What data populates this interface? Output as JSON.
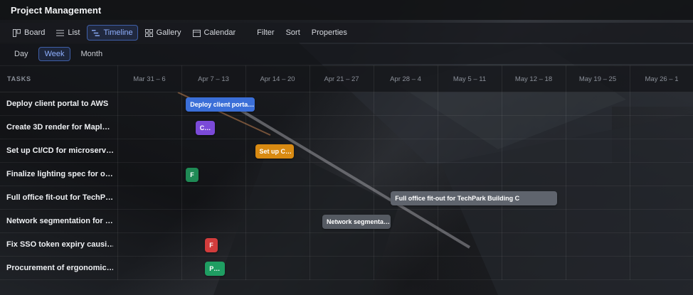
{
  "app": {
    "title": "Project Management"
  },
  "views": [
    {
      "label": "Board",
      "icon": "board-icon",
      "active": false
    },
    {
      "label": "List",
      "icon": "list-icon",
      "active": false
    },
    {
      "label": "Timeline",
      "icon": "timeline-icon",
      "active": true
    },
    {
      "label": "Gallery",
      "icon": "gallery-icon",
      "active": false
    },
    {
      "label": "Calendar",
      "icon": "calendar-icon",
      "active": false
    }
  ],
  "toolbar": {
    "filter": "Filter",
    "sort": "Sort",
    "properties": "Properties"
  },
  "zoom": [
    {
      "label": "Day",
      "active": false
    },
    {
      "label": "Week",
      "active": true
    },
    {
      "label": "Month",
      "active": false
    }
  ],
  "timeline": {
    "tasks_header": "TASKS",
    "weeks": [
      "Mar 31 – 6",
      "Apr 7 – 13",
      "Apr 14 – 20",
      "Apr 21 – 27",
      "Apr 28 – 4",
      "May 5 – 11",
      "May 12 – 18",
      "May 19 – 25",
      "May 26 – 1"
    ],
    "tasks": [
      {
        "name": "Deploy client portal to AWS",
        "bar_label": "Deploy client porta…",
        "color": "#3b6fd8",
        "start_week": 1.07,
        "span_weeks": 1.07
      },
      {
        "name": "Create 3D render for Mapl…",
        "bar_label": "C…",
        "color": "#7b4ad8",
        "start_week": 1.22,
        "span_weeks": 0.3
      },
      {
        "name": "Set up CI/CD for microserv…",
        "bar_label": "Set up C…",
        "color": "#d88a12",
        "start_week": 2.15,
        "span_weeks": 0.6
      },
      {
        "name": "Finalize lighting spec for o…",
        "bar_label": "F",
        "color": "#1f8a55",
        "start_week": 1.07,
        "span_weeks": 0.2
      },
      {
        "name": "Full office fit-out for TechP…",
        "bar_label": "Full office fit-out for TechPark Building C",
        "color": "#5f646d",
        "start_week": 4.27,
        "span_weeks": 2.6
      },
      {
        "name": "Network segmentation for …",
        "bar_label": "Network segmenta…",
        "color": "#555a62",
        "start_week": 3.2,
        "span_weeks": 1.07
      },
      {
        "name": "Fix SSO token expiry causi…",
        "bar_label": "F",
        "color": "#d23c3c",
        "start_week": 1.37,
        "span_weeks": 0.2
      },
      {
        "name": "Procurement of ergonomic…",
        "bar_label": "P…",
        "color": "#1f9e62",
        "start_week": 1.37,
        "span_weeks": 0.31
      }
    ]
  }
}
